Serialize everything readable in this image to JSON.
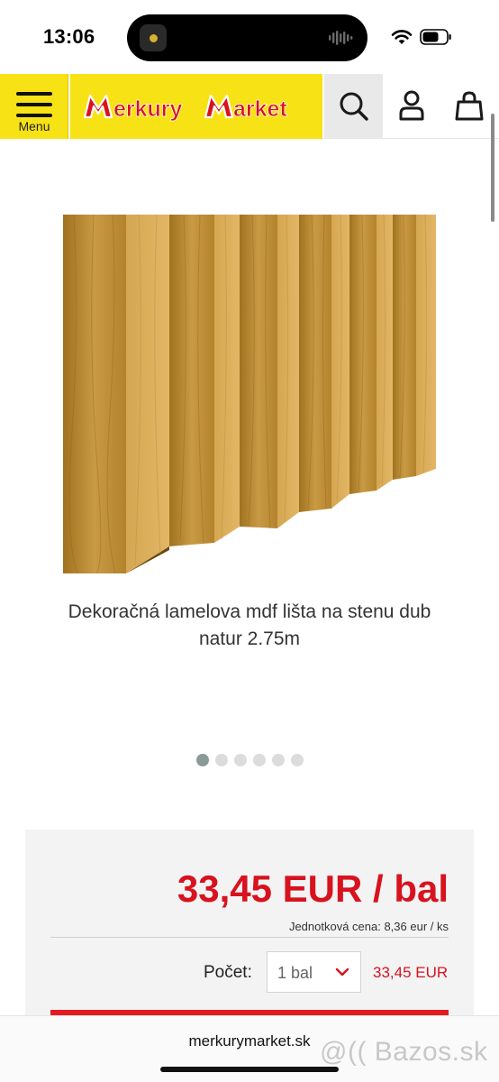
{
  "status_bar": {
    "time": "13:06"
  },
  "header": {
    "menu_label": "Menu",
    "logo_text": "MerkuryMarket",
    "brand_yellow": "#f7e215",
    "brand_red": "#d8121f"
  },
  "product": {
    "title": "Dekoračná lamelova mdf lišta na stenu dub natur 2.75m",
    "image_count": 6,
    "active_image": 1
  },
  "pricing": {
    "price": "33,45 EUR / bal",
    "unit_price": "Jednotková cena: 8,36 eur / ks",
    "quantity_label": "Počet:",
    "quantity_value": "1 bal",
    "line_total": "33,45 EUR"
  },
  "browser": {
    "url": "merkurymarket.sk"
  },
  "watermark": {
    "text": "@(( Bazos.sk"
  },
  "icons": [
    "menu-icon",
    "search-icon",
    "user-icon",
    "bag-icon",
    "chevron-down-icon",
    "wifi-icon",
    "battery-icon"
  ]
}
